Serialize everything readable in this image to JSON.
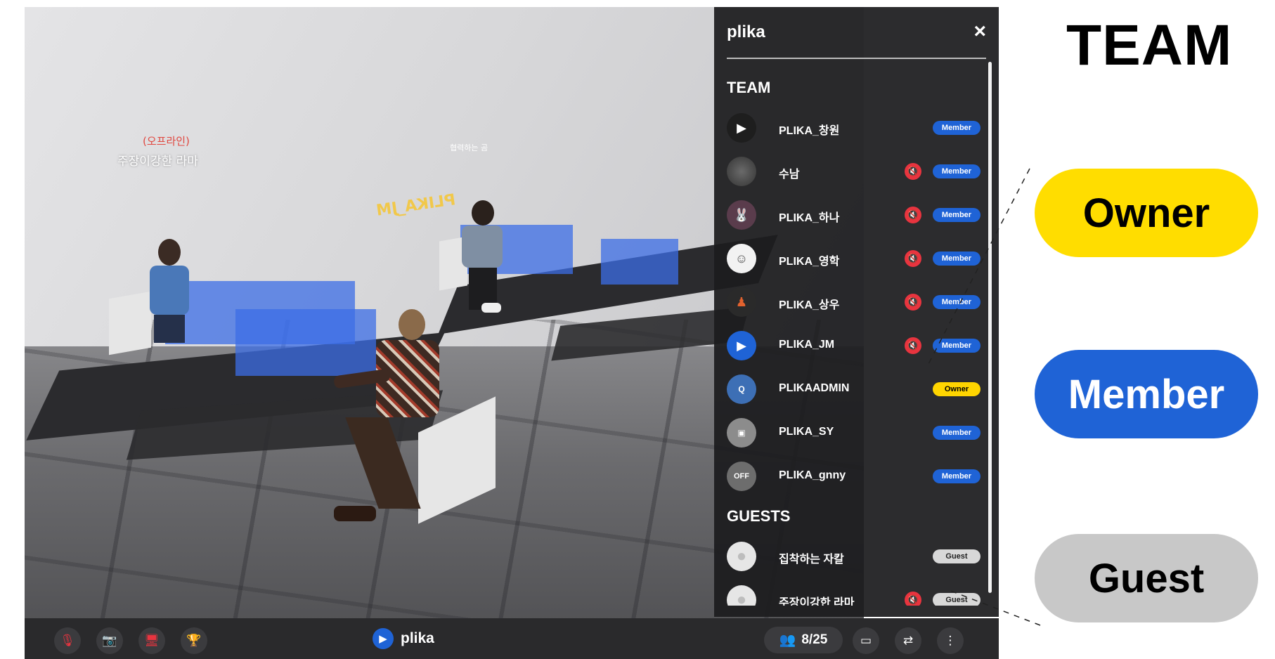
{
  "legend": {
    "title": "TEAM",
    "owner": "Owner",
    "member": "Member",
    "guest": "Guest"
  },
  "scene": {
    "labels": {
      "red": "(오프라인)",
      "white": "주장이강한 라마",
      "small": "협력하는 곰",
      "yellow": "PLIKA_JM"
    }
  },
  "panel": {
    "brand": "plika",
    "close_icon": "×",
    "team_title": "TEAM",
    "guests_title": "GUESTS",
    "team": [
      {
        "name": "PLIKA_창원",
        "role": "Member",
        "muted": false,
        "avatar": "plika-logo-dark"
      },
      {
        "name": "수남",
        "role": "Member",
        "muted": true,
        "avatar": "photo-cat"
      },
      {
        "name": "PLIKA_하나",
        "role": "Member",
        "muted": true,
        "avatar": "character-rabbit"
      },
      {
        "name": "PLIKA_영학",
        "role": "Member",
        "muted": true,
        "avatar": "drawing-face"
      },
      {
        "name": "PLIKA_상우",
        "role": "Member",
        "muted": true,
        "avatar": "orange-figure"
      },
      {
        "name": "PLIKA_JM",
        "role": "Member",
        "muted": true,
        "avatar": "plika-logo-blue"
      },
      {
        "name": "PLIKAADMIN",
        "role": "Owner",
        "muted": false,
        "avatar": "admin-logo"
      },
      {
        "name": "PLIKA_SY",
        "role": "Member",
        "muted": false,
        "avatar": "photo-bag"
      },
      {
        "name": "PLIKA_gnny",
        "role": "Member",
        "muted": false,
        "avatar": "photo-off"
      }
    ],
    "guests": [
      {
        "name": "집착하는 자칼",
        "role": "Guest",
        "muted": false,
        "avatar": "default-user"
      },
      {
        "name": "주장이강한 라마",
        "role": "Guest",
        "muted": true,
        "avatar": "default-user"
      }
    ]
  },
  "bottombar": {
    "controls": [
      "mic-off-icon",
      "camera-off-icon",
      "screen-share-off-icon",
      "trophy-icon"
    ],
    "brand": "plika",
    "participants": "8/25",
    "right_controls": [
      "chat-icon",
      "switch-icon",
      "more-icon"
    ]
  },
  "colors": {
    "member": "#1f63d6",
    "owner": "#ffdd00",
    "guest": "#c8c8c8",
    "mute": "#e8343f"
  }
}
